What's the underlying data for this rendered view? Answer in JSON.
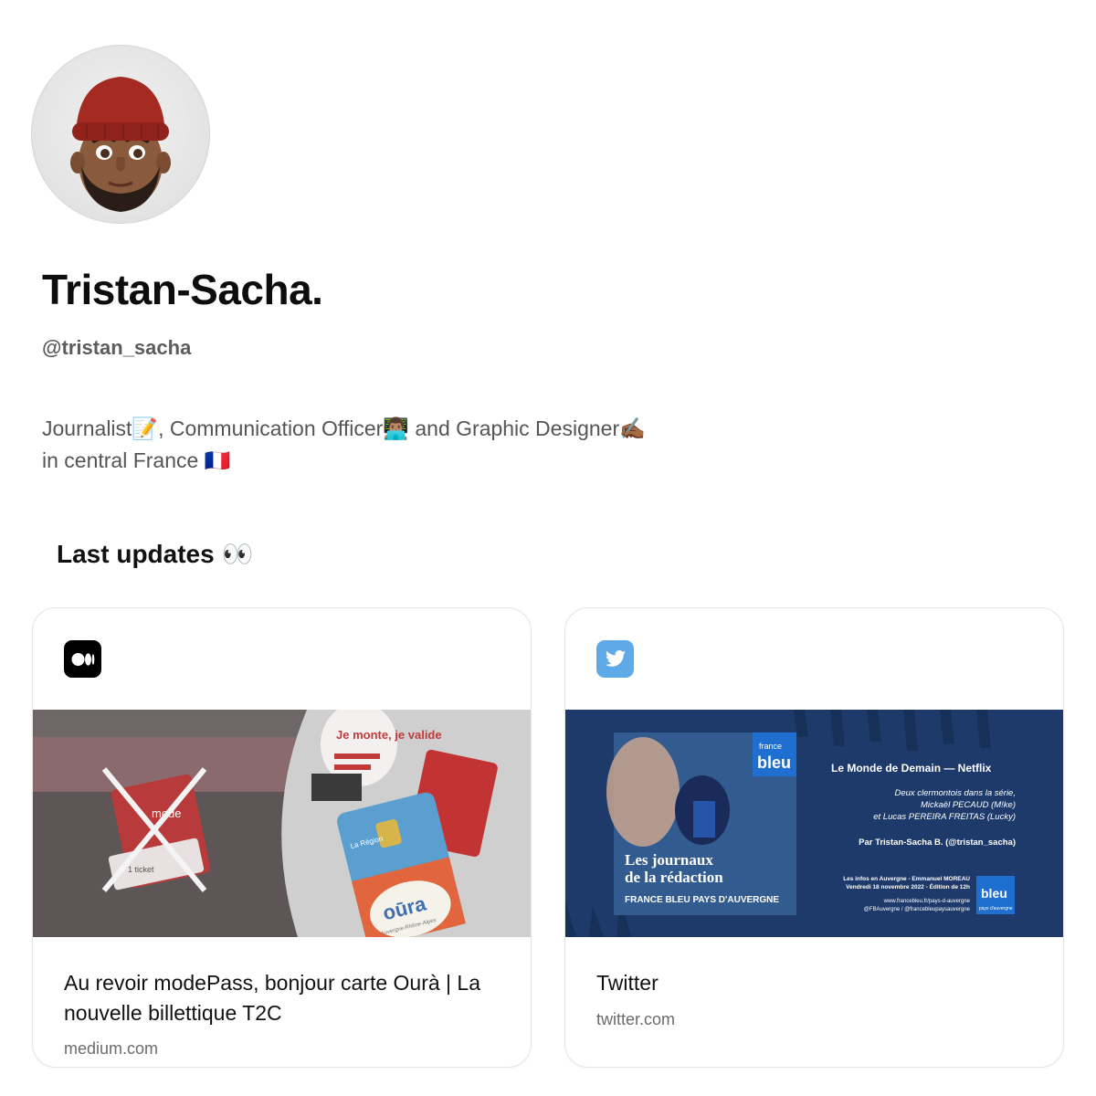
{
  "profile": {
    "name": "Tristan-Sacha.",
    "handle": "@tristan_sacha",
    "bio_line1": "Journalist📝, Communication Officer👨🏽‍💻 and Graphic Designer✍🏾",
    "bio_line2": "in central France 🇫🇷"
  },
  "section": {
    "title": "Last updates 👀"
  },
  "cards": [
    {
      "title": "Au revoir modePass, bonjour carte Ourà | La nouvelle billettique T2C",
      "domain": "medium.com",
      "icon": "medium-icon",
      "thumb_texts": {
        "sticker": "Je monte, je valide",
        "card_brand": "La Région",
        "oura": "oūra",
        "oura_sub": "Auvergne-Rhône-Alpes",
        "ticket": "1 ticket",
        "modepass": "mode"
      }
    },
    {
      "title": "Twitter",
      "domain": "twitter.com",
      "icon": "twitter-bird-icon",
      "thumb_texts": {
        "badge_top": "france",
        "badge_main": "bleu",
        "headline1": "Les journaux",
        "headline2": "de la rédaction",
        "station": "FRANCE BLEU PAYS D'AUVERGNE",
        "show": "Le Monde de Demain — Netflix",
        "desc1": "Deux clermontois dans la série,",
        "desc2": "Mickaël PECAUD (M!ke)",
        "desc3": "et Lucas PEREIRA FREITAS (Lucky)",
        "byline": "Par Tristan-Sacha B. (@tristan_sacha)",
        "info1": "Les infos en Auvergne - Emmanuel MOREAU",
        "info2": "Vendredi 18 novembre 2022 - Édition de 12h",
        "url1": "www.francebleu.fr/pays-d-auvergne",
        "url2": "@FBAuvergne / @francebleupaysauvergne",
        "logo_sub": "pays d'auvergne"
      }
    }
  ],
  "colors": {
    "twitter_blue": "#5ea9e8",
    "francebleu_navy": "#1d3a6b",
    "francebleu_blue": "#1e6fd0",
    "medium_black": "#000000"
  }
}
